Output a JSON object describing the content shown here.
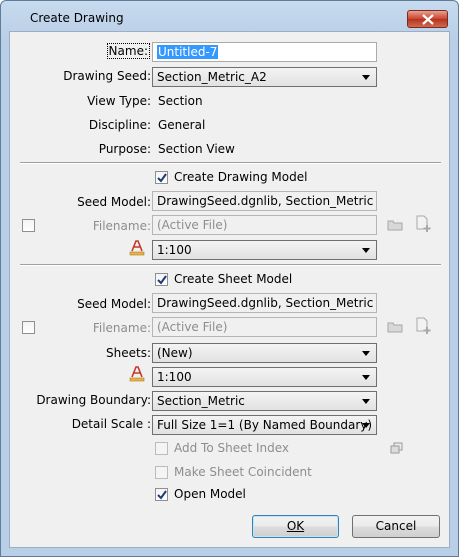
{
  "window": {
    "title": "Create Drawing"
  },
  "form": {
    "name_label": "Name:",
    "name_value": "Untitled-7",
    "drawing_seed_label": "Drawing Seed:",
    "drawing_seed_value": "Section_Metric_A2",
    "view_type_label": "View Type:",
    "view_type_value": "Section",
    "discipline_label": "Discipline:",
    "discipline_value": "General",
    "purpose_label": "Purpose:",
    "purpose_value": "Section View"
  },
  "drawing_model": {
    "create_label": "Create Drawing Model",
    "create_checked": true,
    "seed_label": "Seed Model:",
    "seed_value": "DrawingSeed.dgnlib, Section_Metric",
    "filename_label": "Filename:",
    "filename_value": "(Active File)",
    "scale_value": "1:100"
  },
  "sheet_model": {
    "create_label": "Create Sheet Model",
    "create_checked": true,
    "seed_label": "Seed Model:",
    "seed_value": "DrawingSeed.dgnlib, Section_Metric [She",
    "filename_label": "Filename:",
    "filename_value": "(Active File)",
    "sheets_label": "Sheets:",
    "sheets_value": "(New)",
    "scale_value": "1:100",
    "boundary_label": "Drawing Boundary:",
    "boundary_value": "Section_Metric",
    "detail_scale_label": "Detail Scale :",
    "detail_scale_value": "Full Size 1=1 (By Named Boundary)",
    "add_to_index_label": "Add To Sheet Index",
    "coincident_label": "Make Sheet Coincident",
    "open_model_label": "Open Model",
    "open_model_checked": true
  },
  "buttons": {
    "ok": "OK",
    "cancel": "Cancel"
  },
  "icons": {
    "close": "close-icon",
    "folder": "folder-icon",
    "new_file": "new-file-icon",
    "annotation_scale": "annotation-scale-icon",
    "sheet_index": "sheet-index-icon",
    "dropdown": "chevron-down-icon"
  }
}
